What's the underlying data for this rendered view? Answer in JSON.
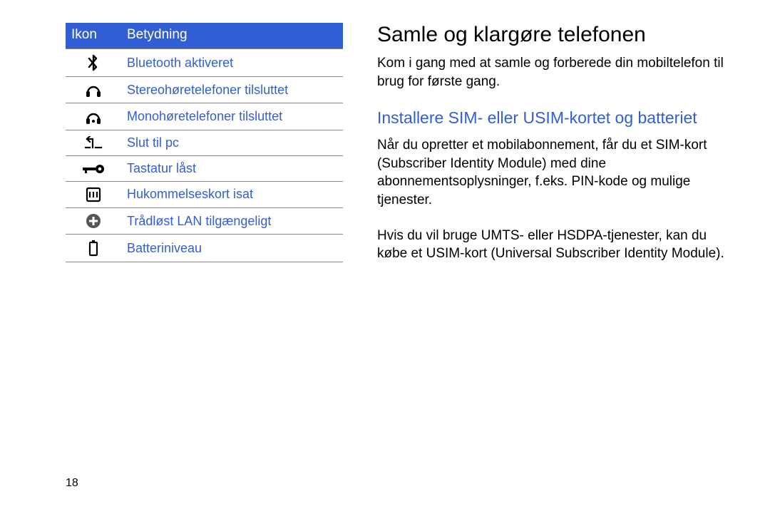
{
  "page_number": "18",
  "table": {
    "header_icon": "Ikon",
    "header_meaning": "Betydning",
    "rows": [
      {
        "icon": "bluetooth-icon",
        "label": "Bluetooth aktiveret"
      },
      {
        "icon": "stereo-headphones-icon",
        "label": "Stereohøretelefoner tilsluttet"
      },
      {
        "icon": "mono-headphones-icon",
        "label": "Monohøretelefoner tilsluttet"
      },
      {
        "icon": "connect-pc-icon",
        "label": "Slut til pc"
      },
      {
        "icon": "key-icon",
        "label": "Tastatur låst"
      },
      {
        "icon": "memory-card-icon",
        "label": "Hukommelseskort isat"
      },
      {
        "icon": "wifi-icon",
        "label": "Trådløst LAN tilgængeligt"
      },
      {
        "icon": "battery-icon",
        "label": "Batteriniveau"
      }
    ]
  },
  "right": {
    "heading": "Samle og klargøre telefonen",
    "intro": "Kom i gang med at samle og forberede din mobiltelefon til brug for første gang.",
    "subheading": "Installere SIM- eller USIM-kortet og batteriet",
    "para1": "Når du opretter et mobilabonnement, får du et SIM-kort (Subscriber Identity Module) med dine abonnementsoplysninger, f.eks. PIN-kode og mulige tjenester.",
    "para2": "Hvis du vil bruge UMTS- eller HSDPA-tjenester, kan du købe et USIM-kort (Universal Subscriber Identity Module)."
  }
}
